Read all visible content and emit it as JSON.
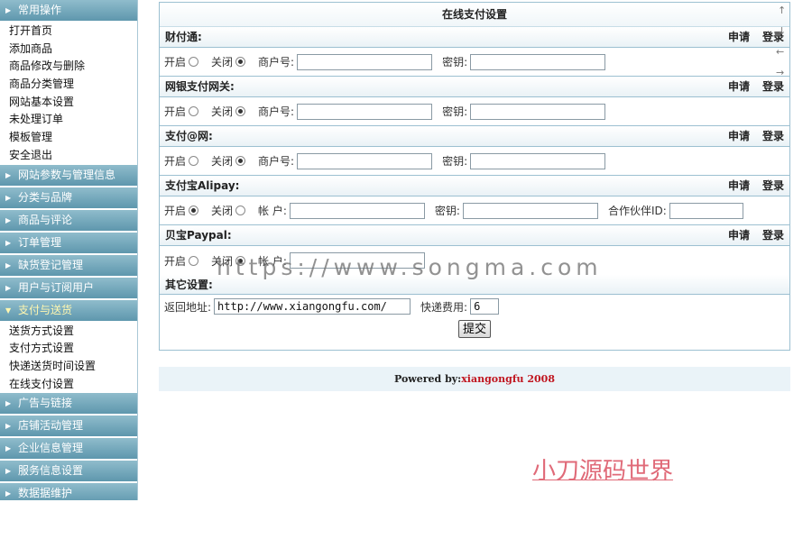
{
  "sidebar": {
    "sections": [
      {
        "label": "常用操作",
        "expanded": true,
        "items": [
          "打开首页",
          "添加商品",
          "商品修改与删除",
          "商品分类管理",
          "网站基本设置",
          "未处理订单",
          "模板管理",
          "安全退出"
        ]
      },
      {
        "label": "网站参数与管理信息"
      },
      {
        "label": "分类与品牌"
      },
      {
        "label": "商品与评论"
      },
      {
        "label": "订单管理"
      },
      {
        "label": "缺货登记管理"
      },
      {
        "label": "用户与订阅用户"
      },
      {
        "label": "支付与送货",
        "expanded": true,
        "active": true,
        "items": [
          "送货方式设置",
          "支付方式设置",
          "快递送货时间设置",
          "在线支付设置"
        ]
      },
      {
        "label": "广告与链接"
      },
      {
        "label": "店铺活动管理"
      },
      {
        "label": "企业信息管理"
      },
      {
        "label": "服务信息设置"
      },
      {
        "label": "数据据维护"
      }
    ]
  },
  "panel": {
    "title": "在线支付设置",
    "apply_label": "申请",
    "login_label": "登录",
    "open_label": "开启",
    "close_label": "关闭",
    "gateways": [
      {
        "name": "财付通:",
        "enabled": false,
        "merchant_label": "商户号:",
        "merchant_value": "",
        "key_label": "密钥:",
        "key_value": "",
        "links": true
      },
      {
        "name": "网银支付网关:",
        "enabled": false,
        "merchant_label": "商户号:",
        "merchant_value": "",
        "key_label": "密钥:",
        "key_value": "",
        "links": true
      },
      {
        "name": "支付@网:",
        "enabled": false,
        "merchant_label": "商户号:",
        "merchant_value": "",
        "key_label": "密钥:",
        "key_value": "",
        "links": true
      },
      {
        "name": "支付宝Alipay:",
        "enabled": true,
        "merchant_label": "帐  户:",
        "merchant_value": "",
        "key_label": "密钥:",
        "key_value": "",
        "partner_label": "合作伙伴ID:",
        "partner_value": "",
        "links": true
      },
      {
        "name": "贝宝Paypal:",
        "enabled": false,
        "merchant_label": "帐  户:",
        "merchant_value": "",
        "links": true
      }
    ],
    "other": {
      "title": "其它设置:",
      "return_label": "返回地址:",
      "return_value": "http://www.xiangongfu.com/",
      "fee_label": "快递费用:",
      "fee_value": "6"
    },
    "submit_label": "提交"
  },
  "footer": {
    "powered_prefix": "Powered by:",
    "powered_brand": "xiangongfu 2008"
  },
  "watermarks": {
    "url": "https://www.songma.com",
    "cn": "小刀源码世界"
  },
  "scroll_icons": [
    "arrow-up",
    "arrow-down",
    "arrow-left",
    "arrow-right"
  ],
  "colors": {
    "sidebar_head": "#6fa6bb",
    "border": "#9cc0d1",
    "footer_bg": "#eaf3f8",
    "brand_red": "#c0151f"
  }
}
